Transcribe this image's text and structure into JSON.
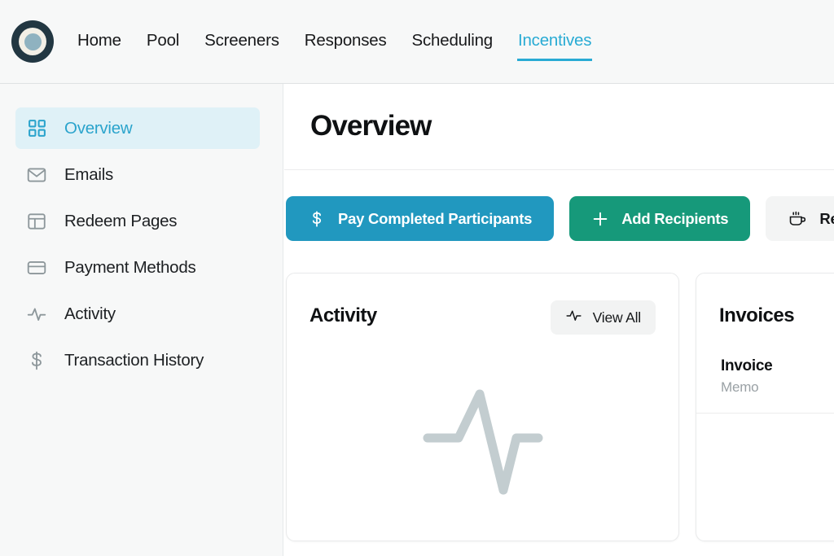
{
  "brand": {
    "accent_teal": "#29abd4",
    "accent_green": "#16997a",
    "logo_name": "app-logo"
  },
  "topnav": {
    "links": [
      {
        "label": "Home",
        "active": false
      },
      {
        "label": "Pool",
        "active": false
      },
      {
        "label": "Screeners",
        "active": false
      },
      {
        "label": "Responses",
        "active": false
      },
      {
        "label": "Scheduling",
        "active": false
      },
      {
        "label": "Incentives",
        "active": true
      }
    ]
  },
  "sidebar": {
    "items": [
      {
        "label": "Overview",
        "icon": "grid-icon",
        "active": true
      },
      {
        "label": "Emails",
        "icon": "envelope-icon",
        "active": false
      },
      {
        "label": "Redeem Pages",
        "icon": "layout-icon",
        "active": false
      },
      {
        "label": "Payment Methods",
        "icon": "credit-card-icon",
        "active": false
      },
      {
        "label": "Activity",
        "icon": "pulse-icon",
        "active": false
      },
      {
        "label": "Transaction History",
        "icon": "dollar-icon",
        "active": false
      }
    ]
  },
  "main": {
    "title": "Overview",
    "actions": [
      {
        "label": "Pay Completed Participants",
        "icon": "dollar-icon",
        "style": "teal"
      },
      {
        "label": "Add Recipients",
        "icon": "plus-icon",
        "style": "green"
      },
      {
        "label": "Record Ext",
        "icon": "coffee-cup-icon",
        "style": "gray"
      }
    ],
    "cards": [
      {
        "title": "Activity",
        "action_label": "View All",
        "action_icon": "pulse-icon",
        "empty_icon": "pulse-illustration"
      },
      {
        "title": "Invoices",
        "rows": [
          {
            "title": "Invoice",
            "sub": "Memo"
          }
        ]
      }
    ]
  }
}
